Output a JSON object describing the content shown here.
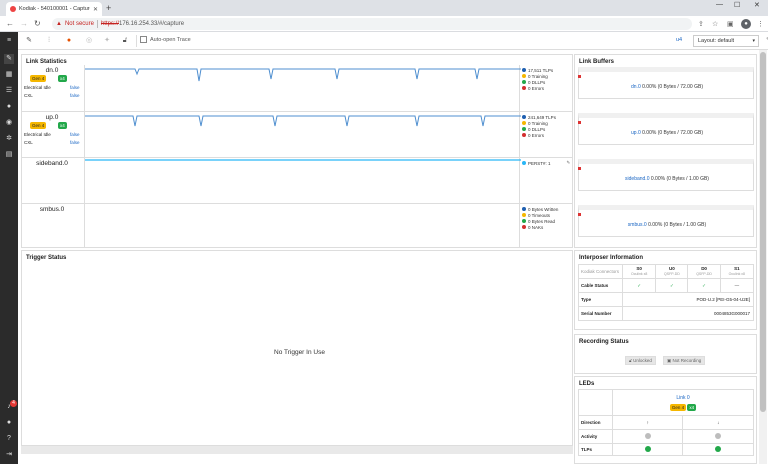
{
  "browser": {
    "tab_title": "Kodiak - 540100001 - Capture",
    "security_label": "Not secure",
    "url_scheme": "https://",
    "url_rest": "176.16.254.33/#/capture"
  },
  "toolbar": {
    "auto_open_label": "Auto-open Trace",
    "u4_label": "u4",
    "layout_value": "Layout: default"
  },
  "link_statistics": {
    "title": "Link Statistics",
    "lanes": [
      {
        "name": "dn.0",
        "gen": "Gen 4",
        "width": "x4",
        "kv": [
          {
            "k": "Electrical Idle",
            "v": "false"
          },
          {
            "k": "CXL",
            "v": "false"
          }
        ],
        "legend": [
          {
            "text": "17,511 TLPs",
            "color": "#1f5fb0"
          },
          {
            "text": "0 Training",
            "color": "#f5b700"
          },
          {
            "text": "0 DLLPs",
            "color": "#22a84a"
          },
          {
            "text": "0 Errors",
            "color": "#d32f2f"
          }
        ]
      },
      {
        "name": "up.0",
        "gen": "Gen 4",
        "width": "x4",
        "kv": [
          {
            "k": "Electrical Idle",
            "v": "false"
          },
          {
            "k": "CXL",
            "v": "false"
          }
        ],
        "legend": [
          {
            "text": "241,649 TLPs",
            "color": "#1f5fb0"
          },
          {
            "text": "0 Training",
            "color": "#f5b700"
          },
          {
            "text": "0 DLLPs",
            "color": "#22a84a"
          },
          {
            "text": "0 Errors",
            "color": "#d32f2f"
          }
        ]
      },
      {
        "name": "sideband.0",
        "legend": [
          {
            "text": "PERST#: 1",
            "color": "#29b6f6"
          }
        ]
      },
      {
        "name": "smbus.0",
        "legend": [
          {
            "text": "0 Bytes Written",
            "color": "#1f5fb0"
          },
          {
            "text": "0 Timeouts",
            "color": "#f5b700"
          },
          {
            "text": "0 Bytes Read",
            "color": "#22a84a"
          },
          {
            "text": "0 NAKs",
            "color": "#d32f2f"
          }
        ]
      }
    ]
  },
  "link_buffers": {
    "title": "Link Buffers",
    "items": [
      {
        "name": "dn.0",
        "text": "0.00% (0 Bytes / 72.00 GB)"
      },
      {
        "name": "up.0",
        "text": "0.00% (0 Bytes / 72.00 GB)"
      },
      {
        "name": "sideband.0",
        "text": "0.00% (0 Bytes / 1.00 GB)"
      },
      {
        "name": "smbus.0",
        "text": "0.00% (0 Bytes / 1.00 GB)"
      }
    ]
  },
  "trigger_status": {
    "title": "Trigger Status",
    "message": "No Trigger In Use"
  },
  "interposer": {
    "title": "Interposer Information",
    "header_label": "Kodiak Connectors",
    "columns": [
      {
        "name": "S0",
        "sub": "Oculink x8"
      },
      {
        "name": "U0",
        "sub": "QSFP-DD"
      },
      {
        "name": "D0",
        "sub": "QSFP-DD"
      },
      {
        "name": "S1",
        "sub": "Oculink x8"
      }
    ],
    "cable_status_label": "Cable Status",
    "cable_status": [
      "✓",
      "✓",
      "✓",
      "—"
    ],
    "type_label": "Type",
    "type_value": "POD-U.2 [PEI-G5-04-U2E]",
    "serial_label": "Serial Number",
    "serial_value": "0004853G000017"
  },
  "recording_status": {
    "title": "Recording Status",
    "unlocked": "Unlocked",
    "not_recording": "Not Recording"
  },
  "leds": {
    "title": "LEDs",
    "link_label": "Link 0",
    "gen": "Gen 4",
    "width": "x4",
    "direction_label": "Direction",
    "activity_label": "Activity",
    "tlps_label": "TLPs"
  },
  "sidebar": {
    "badge_count": "4"
  },
  "colors": {
    "trace_blue": "#4f8fd0",
    "sideband_cyan": "#29b6f6",
    "led_gray": "#bdbdbd",
    "led_green": "#22a84a"
  }
}
